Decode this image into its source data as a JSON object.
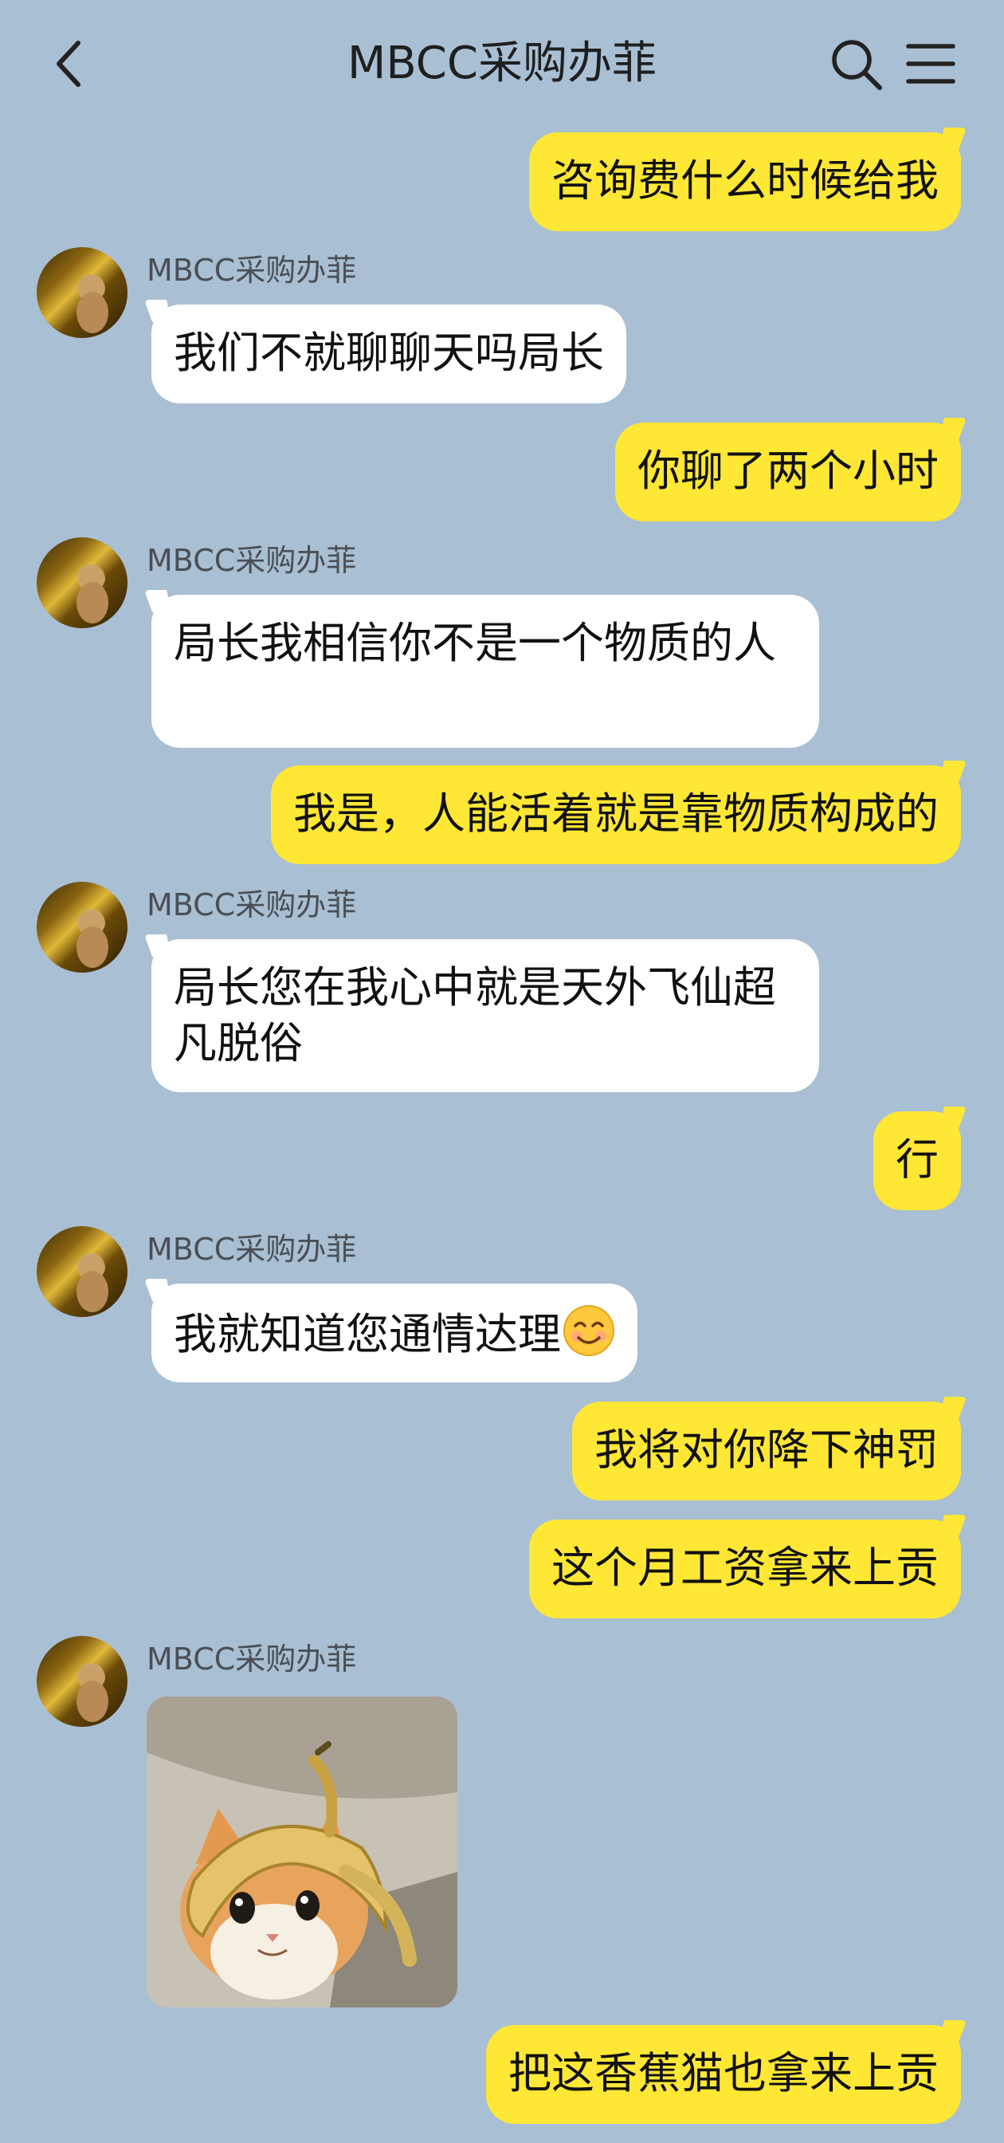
{
  "header": {
    "title": "MBCC采购办菲",
    "back_icon": "chevron-left-icon",
    "search_icon": "search-icon",
    "menu_icon": "menu-icon"
  },
  "colors": {
    "background": "#a9bfd3",
    "outgoing_bubble": "#ffe735",
    "incoming_bubble": "#ffffff"
  },
  "messages": [
    {
      "dir": "out",
      "text": "咨询费什么时候给我"
    },
    {
      "dir": "in",
      "sender": "MBCC采购办菲",
      "text": "我们不就聊聊天吗局长"
    },
    {
      "dir": "out",
      "text": "你聊了两个小时"
    },
    {
      "dir": "in",
      "sender": "MBCC采购办菲",
      "text": "局长我相信你不是一个物质的人"
    },
    {
      "dir": "out",
      "text": "我是，人能活着就是靠物质构成的"
    },
    {
      "dir": "in",
      "sender": "MBCC采购办菲",
      "text": "局长您在我心中就是天外飞仙超凡脱俗"
    },
    {
      "dir": "out",
      "text": "行"
    },
    {
      "dir": "in",
      "sender": "MBCC采购办菲",
      "text": "我就知道您通情达理",
      "emoji": "smiling-face-emoji"
    },
    {
      "dir": "out",
      "text": "我将对你降下神罚"
    },
    {
      "dir": "out",
      "text": "这个月工资拿来上贡"
    },
    {
      "dir": "in",
      "sender": "MBCC采购办菲",
      "image": "cat-with-banana-peel-photo"
    },
    {
      "dir": "out",
      "text": "把这香蕉猫也拿来上贡"
    }
  ]
}
